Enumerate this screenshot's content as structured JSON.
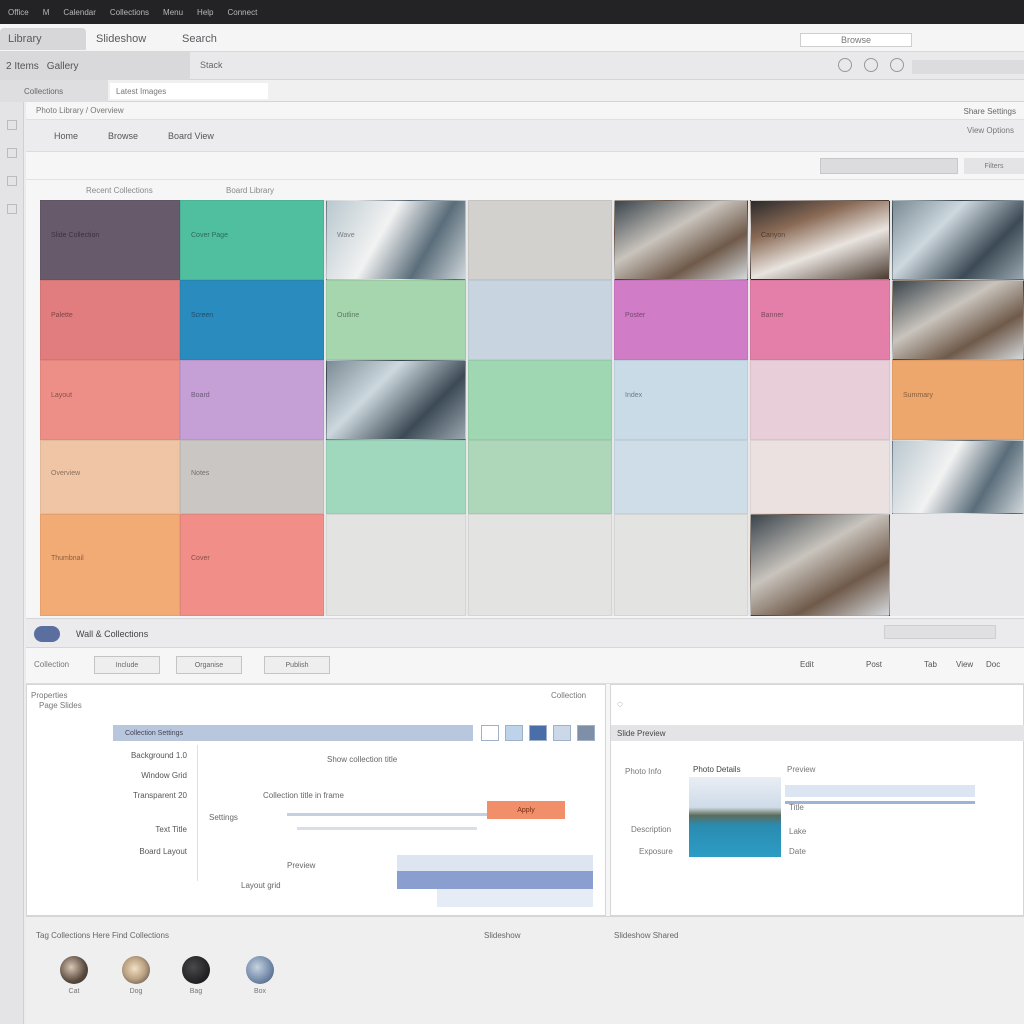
{
  "system_bar": {
    "items": [
      "Office",
      "M",
      "Calendar",
      "Collections",
      "Menu",
      "Help",
      "Connect"
    ]
  },
  "tabs": [
    {
      "label": "Library",
      "active": true
    },
    {
      "label": "Slideshow"
    },
    {
      "label": "Search"
    }
  ],
  "tab_url": "Browse",
  "nav": {
    "left_label": "2 Items",
    "left_label2": "Gallery",
    "mid_label": "Stack"
  },
  "subbar": {
    "left": "Collections",
    "field": "Latest Images"
  },
  "crumb": {
    "text": "Photo Library / Overview",
    "right": "Share Settings"
  },
  "toolbar": {
    "items": [
      "Home",
      "Browse",
      "Board View"
    ],
    "right": "View Options"
  },
  "filter": {
    "button2": "Filters"
  },
  "gallery_labels": {
    "left": "Recent Collections",
    "right": "Board Library"
  },
  "gallery": {
    "tiles": [
      {
        "color": "#675b6b",
        "caption": "Slide Collection"
      },
      {
        "color": "#4fbf9f",
        "caption": "Cover Page"
      },
      {
        "style": "photo3",
        "caption": "Wave"
      },
      {
        "color": "#d3d1cd",
        "caption": ""
      },
      {
        "style": "photo4",
        "caption": ""
      },
      {
        "style": "photo2",
        "caption": "Canyon"
      },
      {
        "style": "photo",
        "caption": ""
      },
      {
        "color": "#e17c7f",
        "caption": "Palette"
      },
      {
        "color": "#2a8cbe",
        "caption": "Screen"
      },
      {
        "color": "#a5d6ad",
        "caption": "Outline"
      },
      {
        "color": "#c8d5e0",
        "caption": ""
      },
      {
        "color": "#d17cc6",
        "caption": "Poster"
      },
      {
        "color": "#e37fa8",
        "caption": "Banner"
      },
      {
        "style": "photo4",
        "caption": ""
      },
      {
        "color": "#ee8f87",
        "caption": "Layout"
      },
      {
        "color": "#c4a0d6",
        "caption": "Board"
      },
      {
        "style": "photo",
        "caption": ""
      },
      {
        "color": "#9fd7b2",
        "caption": ""
      },
      {
        "color": "#c8dbe6",
        "caption": "Index"
      },
      {
        "color": "#e8ced8",
        "caption": ""
      },
      {
        "color": "#eda66c",
        "caption": "Summary"
      },
      {
        "color": "#f0c5a5",
        "caption": "Overview"
      },
      {
        "color": "#c9c6c4",
        "caption": "Notes"
      },
      {
        "color": "#9fd8bd",
        "caption": ""
      },
      {
        "color": "#aed6b9",
        "caption": ""
      },
      {
        "color": "#cfdde8",
        "caption": ""
      },
      {
        "color": "#ebe1e1",
        "caption": ""
      },
      {
        "style": "photo3",
        "caption": ""
      },
      {
        "color": "#f3ab75",
        "caption": "Thumbnail"
      },
      {
        "color": "#f08e87",
        "caption": "Cover"
      },
      {
        "color": "#e3e3e1",
        "caption": ""
      },
      {
        "color": "#e3e3e1",
        "caption": ""
      },
      {
        "color": "#e3e3e1",
        "caption": ""
      },
      {
        "style": "photo4",
        "caption": ""
      }
    ]
  },
  "section2": {
    "title": "Wall & Collections"
  },
  "actbar": {
    "label": "Collection",
    "buttons": [
      "Include",
      "Organise",
      "Publish"
    ],
    "icons": [
      "Edit",
      "Post",
      "Tab",
      "View",
      "Doc"
    ]
  },
  "panel_left": {
    "header": "Properties",
    "subheader": "Page Slides",
    "title_strip": "Collection Settings",
    "right_header": "Collection",
    "rows": [
      {
        "label": "Background",
        "value": "1.0"
      },
      {
        "label": "Window",
        "value": "Grid"
      },
      {
        "label": "Transparent",
        "value": "20"
      },
      {
        "label": "Text",
        "value": "Title"
      },
      {
        "label": "Board",
        "value": "Layout"
      }
    ],
    "mid_texts": [
      "Show collection title",
      "Collection title in frame",
      "Settings",
      "Preview",
      "Layout grid"
    ],
    "orange_button": "Apply"
  },
  "panel_right": {
    "title": "Slide Preview",
    "caption": "Photo Details",
    "labels": [
      "Photo Info",
      "Description",
      "Exposure"
    ],
    "info_header": "Preview",
    "values": [
      "Title",
      "Lake",
      "Date"
    ]
  },
  "footer": {
    "left": "Tag Collections Here Find Collections",
    "mid": "Slideshow",
    "right": "Slideshow Shared"
  },
  "dock": {
    "items": [
      {
        "label": "Cat"
      },
      {
        "label": "Dog"
      },
      {
        "label": "Bag"
      },
      {
        "label": "Box"
      }
    ]
  }
}
